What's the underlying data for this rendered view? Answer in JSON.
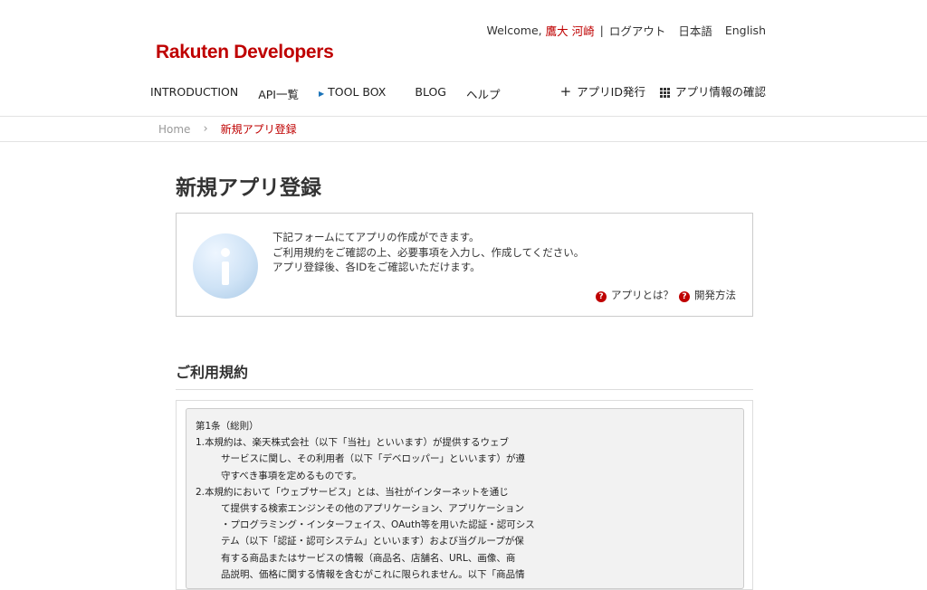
{
  "header": {
    "welcome": "Welcome,",
    "user_name": "鷹大 河崎",
    "separator": "|",
    "logout": "ログアウト",
    "lang_ja": "日本語",
    "lang_en": "English",
    "logo": "Rakuten Developers"
  },
  "nav": {
    "items": [
      {
        "label": "INTRODUCTION"
      },
      {
        "label": "API一覧"
      },
      {
        "label": "TOOL BOX"
      },
      {
        "label": "BLOG"
      },
      {
        "label": "ヘルプ"
      }
    ],
    "issue_app_id": "アプリID発行",
    "check_app_info": "アプリ情報の確認"
  },
  "breadcrumb": {
    "home": "Home",
    "current": "新規アプリ登録"
  },
  "page_title": "新規アプリ登録",
  "info": {
    "lines": [
      "下記フォームにてアプリの作成ができます。",
      "ご利用規約をご確認の上、必要事項を入力し、作成してください。",
      "アプリ登録後、各IDをご確認いただけます。"
    ],
    "link_what_is_app": "アプリとは？",
    "link_dev_method": "開発方法"
  },
  "terms": {
    "title": "ご利用規約",
    "lines": [
      {
        "text": "第1条（総則）",
        "indent": false
      },
      {
        "text": "1.本規約は、楽天株式会社（以下「当社」といいます）が提供するウェブ",
        "indent": false
      },
      {
        "text": "サービスに関し、その利用者（以下「デベロッパー」といいます）が遵",
        "indent": true
      },
      {
        "text": "守すべき事項を定めるものです。",
        "indent": true
      },
      {
        "text": "2.本規約において「ウェブサービス」とは、当社がインターネットを通じ",
        "indent": false
      },
      {
        "text": "て提供する検索エンジンその他のアプリケーション、アプリケーション",
        "indent": true
      },
      {
        "text": "・プログラミング・インターフェイス、OAuth等を用いた認証・認可シス",
        "indent": true
      },
      {
        "text": "テム（以下「認証・認可システム」といいます）および当グループが保",
        "indent": true
      },
      {
        "text": "有する商品またはサービスの情報（商品名、店舗名、URL、画像、商",
        "indent": true
      },
      {
        "text": "品説明、価格に関する情報を含むがこれに限られません。以下「商品情",
        "indent": true
      }
    ]
  }
}
